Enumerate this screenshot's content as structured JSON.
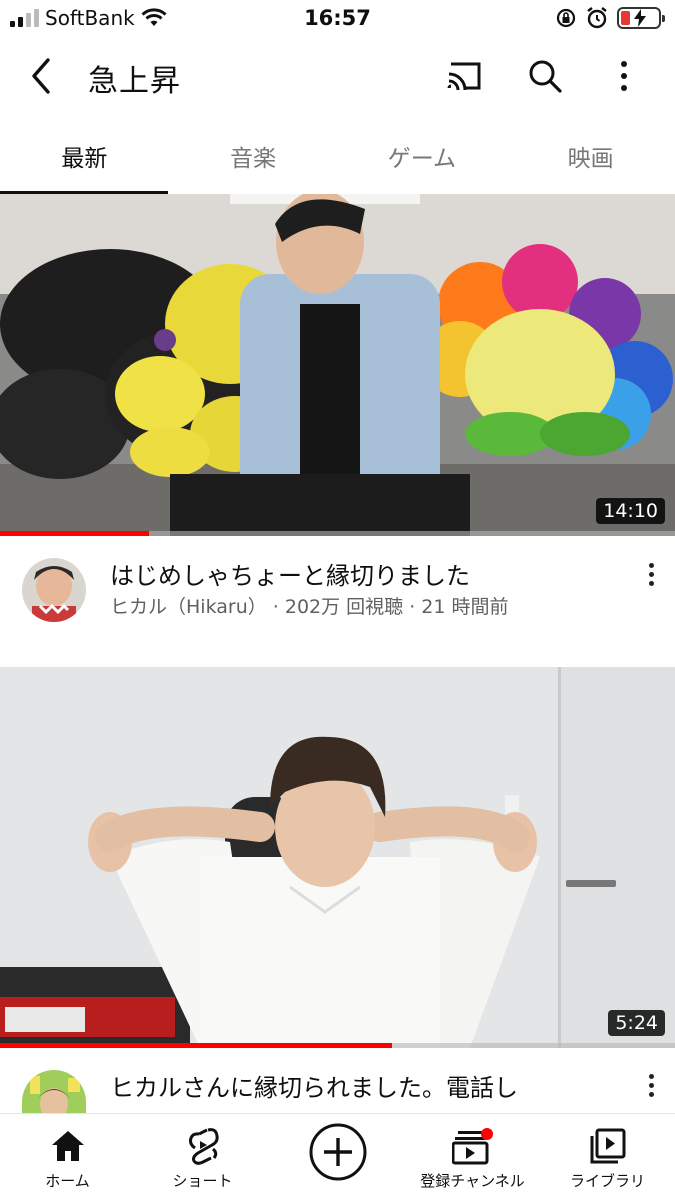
{
  "status_bar": {
    "carrier": "SoftBank",
    "time": "16:57"
  },
  "header": {
    "title": "急上昇",
    "icons": [
      "back-icon",
      "cast-icon",
      "search-icon",
      "more-vert-icon"
    ]
  },
  "tabs": [
    {
      "label": "最新",
      "active": true
    },
    {
      "label": "音楽",
      "active": false
    },
    {
      "label": "ゲーム",
      "active": false
    },
    {
      "label": "映画",
      "active": false
    }
  ],
  "videos": [
    {
      "title": "はじめしゃちょーと縁切りました",
      "channel": "ヒカル（Hikaru）",
      "meta": " · 202万 回視聴 · 21 時間前",
      "duration": "14:10",
      "watched_fraction": 0.22
    },
    {
      "title": "ヒカルさんに縁切られました。電話し",
      "duration": "5:24",
      "watched_fraction": 0.58
    }
  ],
  "bottom_nav": [
    {
      "label": "ホーム",
      "icon": "home-icon"
    },
    {
      "label": "ショート",
      "icon": "shorts-icon"
    },
    {
      "label": "",
      "icon": "create-plus-icon"
    },
    {
      "label": "登録チャンネル",
      "icon": "subscriptions-icon"
    },
    {
      "label": "ライブラリ",
      "icon": "library-icon"
    }
  ],
  "colors": {
    "accent": "#ff0000",
    "text": "#0f0f0f",
    "secondary_text": "#606060"
  }
}
